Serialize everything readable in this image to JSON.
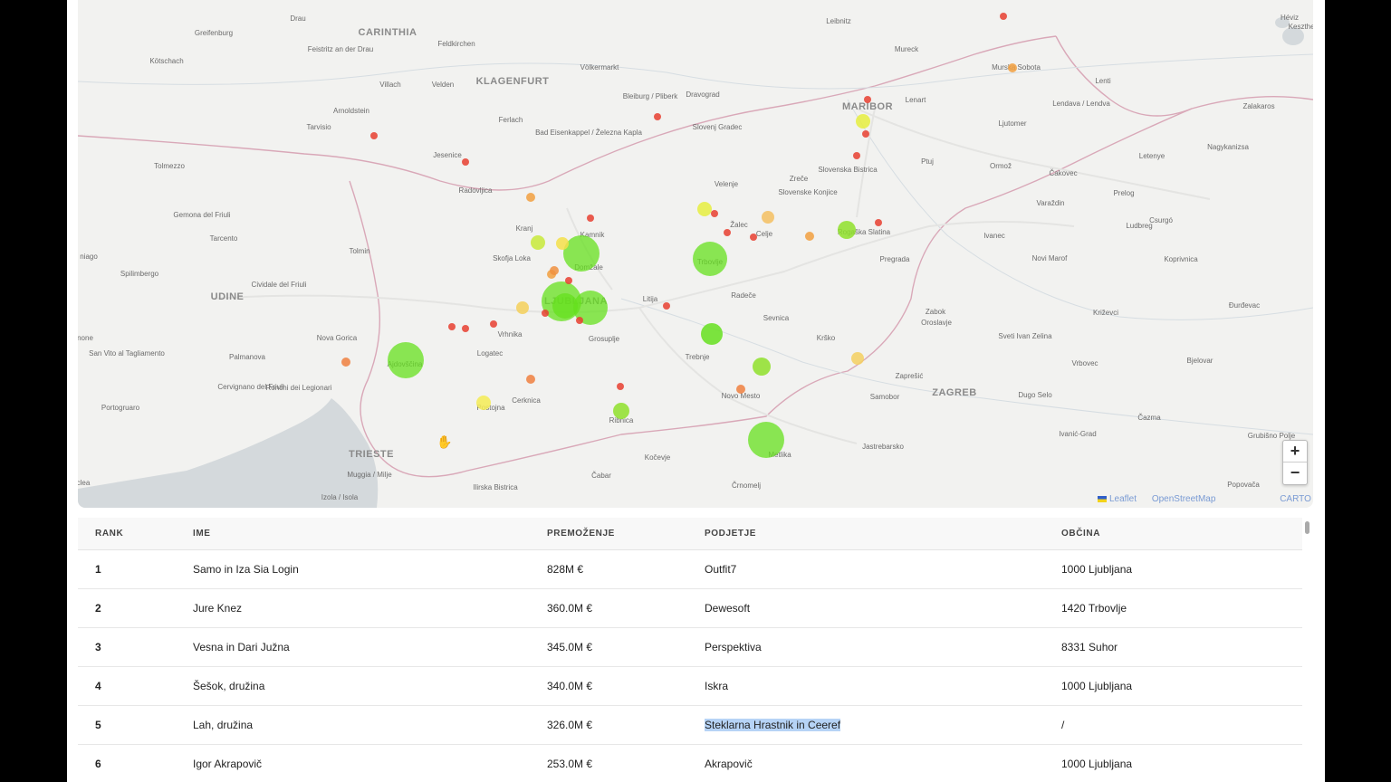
{
  "map": {
    "labels": [
      {
        "name": "Drau",
        "size": "s"
      },
      {
        "name": "CARINTHIA",
        "size": "big"
      },
      {
        "name": "Greifenburg",
        "size": "s"
      },
      {
        "name": "Feistritz an der Drau",
        "size": "s"
      },
      {
        "name": "Feldkirchen",
        "size": "s"
      },
      {
        "name": "Kötschach",
        "size": "s"
      },
      {
        "name": "Völkermarkt",
        "size": "s"
      },
      {
        "name": "KLAGENFURT",
        "size": "big"
      },
      {
        "name": "Villach",
        "size": "s"
      },
      {
        "name": "Velden",
        "size": "s"
      },
      {
        "name": "Arnoldstein",
        "size": "s"
      },
      {
        "name": "Ferlach",
        "size": "s"
      },
      {
        "name": "Bleiburg / Pliberk",
        "size": "s"
      },
      {
        "name": "Dravograd",
        "size": "s"
      },
      {
        "name": "Slovenj Gradec",
        "size": "s"
      },
      {
        "name": "Bad Eisenkappel / Železna Kapla",
        "size": "s"
      },
      {
        "name": "Tarvisio",
        "size": "s"
      },
      {
        "name": "Jesenice",
        "size": "s"
      },
      {
        "name": "Radovljica",
        "size": "s"
      },
      {
        "name": "Tolmezzo",
        "size": "s"
      },
      {
        "name": "Gemona del Friuli",
        "size": "s"
      },
      {
        "name": "Tarcento",
        "size": "s"
      },
      {
        "name": "Tolmin",
        "size": "s"
      },
      {
        "name": "Kranj",
        "size": "s"
      },
      {
        "name": "Kamnik",
        "size": "s"
      },
      {
        "name": "Skofja Loka",
        "size": "s"
      },
      {
        "name": "Domžale",
        "size": "s"
      },
      {
        "name": "Velenje",
        "size": "s"
      },
      {
        "name": "Žalec",
        "size": "s"
      },
      {
        "name": "Celje",
        "size": "s"
      },
      {
        "name": "Trbovlje",
        "size": "s"
      },
      {
        "name": "Litija",
        "size": "s"
      },
      {
        "name": "Radeče",
        "size": "s"
      },
      {
        "name": "Zreče",
        "size": "s"
      },
      {
        "name": "Slovenske Konjice",
        "size": "s"
      },
      {
        "name": "Slovenska Bistrica",
        "size": "s"
      },
      {
        "name": "MARIBOR",
        "size": "big"
      },
      {
        "name": "Lenart",
        "size": "s"
      },
      {
        "name": "Mureck",
        "size": "s"
      },
      {
        "name": "Leibnitz",
        "size": "s"
      },
      {
        "name": "Murska Sobota",
        "size": "s"
      },
      {
        "name": "Ljutomer",
        "size": "s"
      },
      {
        "name": "Ptuj",
        "size": "s"
      },
      {
        "name": "Ormož",
        "size": "s"
      },
      {
        "name": "Lendava / Lendva",
        "size": "s"
      },
      {
        "name": "Lenti",
        "size": "s"
      },
      {
        "name": "Zalakaros",
        "size": "s"
      },
      {
        "name": "Nagykanizsa",
        "size": "s"
      },
      {
        "name": "Letenye",
        "size": "s"
      },
      {
        "name": "Čakovec",
        "size": "s"
      },
      {
        "name": "Varaždin",
        "size": "s"
      },
      {
        "name": "Prelog",
        "size": "s"
      },
      {
        "name": "Ludbreg",
        "size": "s"
      },
      {
        "name": "Csurgó",
        "size": "s"
      },
      {
        "name": "Ivanec",
        "size": "s"
      },
      {
        "name": "Novi Marof",
        "size": "s"
      },
      {
        "name": "Koprivnica",
        "size": "s"
      },
      {
        "name": "Rogaška Slatina",
        "size": "s"
      },
      {
        "name": "Pregrada",
        "size": "s"
      },
      {
        "name": "Zabok",
        "size": "s"
      },
      {
        "name": "Oroslavje",
        "size": "s"
      },
      {
        "name": "Sveti Ivan Zelina",
        "size": "s"
      },
      {
        "name": "Križevci",
        "size": "s"
      },
      {
        "name": "Đurđevac",
        "size": "s"
      },
      {
        "name": "Bjelovar",
        "size": "s"
      },
      {
        "name": "Vrbovec",
        "size": "s"
      },
      {
        "name": "ZAGREB",
        "size": "big"
      },
      {
        "name": "Dugo Selo",
        "size": "s"
      },
      {
        "name": "Samobor",
        "size": "s"
      },
      {
        "name": "Zaprešić",
        "size": "s"
      },
      {
        "name": "Ivanić-Grad",
        "size": "s"
      },
      {
        "name": "Čazma",
        "size": "s"
      },
      {
        "name": "Grubišno Polje",
        "size": "s"
      },
      {
        "name": "Popovača",
        "size": "s"
      },
      {
        "name": "Jastrebarsko",
        "size": "s"
      },
      {
        "name": "Krško",
        "size": "s"
      },
      {
        "name": "Sevnica",
        "size": "s"
      },
      {
        "name": "Trebnje",
        "size": "s"
      },
      {
        "name": "Novo Mesto",
        "size": "s"
      },
      {
        "name": "Metlika",
        "size": "s"
      },
      {
        "name": "Črnomelj",
        "size": "s"
      },
      {
        "name": "Kočevje",
        "size": "s"
      },
      {
        "name": "Ribnica",
        "size": "s"
      },
      {
        "name": "Grosuplje",
        "size": "s"
      },
      {
        "name": "LJUBLJANA",
        "size": "big"
      },
      {
        "name": "Vrhnika",
        "size": "s"
      },
      {
        "name": "Logatec",
        "size": "s"
      },
      {
        "name": "Cerknica",
        "size": "s"
      },
      {
        "name": "Postojna",
        "size": "s"
      },
      {
        "name": "Čabar",
        "size": "s"
      },
      {
        "name": "Ilirska Bistrica",
        "size": "s"
      },
      {
        "name": "Ajdovščina",
        "size": "s"
      },
      {
        "name": "Nova Gorica",
        "size": "s"
      },
      {
        "name": "UDINE",
        "size": "big"
      },
      {
        "name": "Cividale del Friuli",
        "size": "s"
      },
      {
        "name": "Spilimbergo",
        "size": "s"
      },
      {
        "name": "Palmanova",
        "size": "s"
      },
      {
        "name": "San Vito al Tagliamento",
        "size": "s"
      },
      {
        "name": "Cervignano del Friuli",
        "size": "s"
      },
      {
        "name": "Ronchi dei Legionari",
        "size": "s"
      },
      {
        "name": "Portogruaro",
        "size": "s"
      },
      {
        "name": "TRIESTE",
        "size": "big"
      },
      {
        "name": "Muggia / Milje",
        "size": "s"
      },
      {
        "name": "Izola / Isola",
        "size": "s"
      },
      {
        "name": "Héviz",
        "size": "s"
      },
      {
        "name": "Keszthely",
        "size": "s"
      },
      {
        "name": "niago",
        "size": "s"
      },
      {
        "name": "none",
        "size": "s"
      },
      {
        "name": "clea",
        "size": "s"
      },
      {
        "name": "Da",
        "size": "s"
      }
    ],
    "markers": [
      {
        "color": "#66e01e",
        "r": 22,
        "name": "Samo in Iza Sia Login"
      },
      {
        "color": "#66e01e",
        "r": 20
      },
      {
        "color": "#66e01e",
        "r": 19
      },
      {
        "color": "#66e01e",
        "r": 19
      },
      {
        "color": "#66e01e",
        "r": 20
      },
      {
        "color": "#66e01e",
        "r": 20
      },
      {
        "color": "#66e01e",
        "r": 14
      },
      {
        "color": "#66e01e",
        "r": 12
      },
      {
        "color": "#8fe02a",
        "r": 10
      },
      {
        "color": "#8fe02a",
        "r": 10
      },
      {
        "color": "#8fe02a",
        "r": 9
      },
      {
        "color": "#c8ea3a",
        "r": 8
      },
      {
        "color": "#e6ee40",
        "r": 8
      },
      {
        "color": "#e6ee40",
        "r": 8
      },
      {
        "color": "#f5ec55",
        "r": 8
      },
      {
        "color": "#f5e04a",
        "r": 7
      },
      {
        "color": "#f5d05a",
        "r": 7
      },
      {
        "color": "#f5d060",
        "r": 7
      },
      {
        "color": "#f5c060",
        "r": 7
      },
      {
        "color": "#f2a040",
        "r": 5
      },
      {
        "color": "#f2a040",
        "r": 5
      },
      {
        "color": "#f2a040",
        "r": 5
      },
      {
        "color": "#f2a040",
        "r": 5
      },
      {
        "color": "#f09040",
        "r": 5
      },
      {
        "color": "#f08040",
        "r": 5
      },
      {
        "color": "#f08040",
        "r": 5
      },
      {
        "color": "#f08040",
        "r": 5
      },
      {
        "color": "#e84030",
        "r": 4
      },
      {
        "color": "#e84030",
        "r": 4
      },
      {
        "color": "#e84030",
        "r": 4
      },
      {
        "color": "#e84030",
        "r": 4
      },
      {
        "color": "#e84030",
        "r": 4
      },
      {
        "color": "#e84030",
        "r": 4
      },
      {
        "color": "#e84030",
        "r": 4
      },
      {
        "color": "#e84030",
        "r": 4
      },
      {
        "color": "#e84030",
        "r": 4
      },
      {
        "color": "#e84030",
        "r": 4
      },
      {
        "color": "#e84030",
        "r": 4
      },
      {
        "color": "#e84030",
        "r": 4
      },
      {
        "color": "#e84030",
        "r": 4
      },
      {
        "color": "#e84030",
        "r": 4
      },
      {
        "color": "#e84030",
        "r": 4
      },
      {
        "color": "#e84030",
        "r": 4
      },
      {
        "color": "#e84030",
        "r": 4
      },
      {
        "color": "#e84030",
        "r": 4
      },
      {
        "color": "#e84030",
        "r": 4
      },
      {
        "color": "#e84030",
        "r": 4
      }
    ],
    "zoom_in": "+",
    "zoom_out": "−",
    "attribution": {
      "leaflet": "Leaflet",
      "osm": "OpenStreetMap",
      "carto": "CARTO"
    }
  },
  "table": {
    "headers": [
      "RANK",
      "IME",
      "PREMOŽENJE",
      "PODJETJE",
      "OBČINA"
    ],
    "rows": [
      [
        "1",
        "Samo in Iza Sia Login",
        "828M €",
        "Outfit7",
        "1000 Ljubljana"
      ],
      [
        "2",
        "Jure Knez",
        "360.0M €",
        "Dewesoft",
        "1420 Trbovlje"
      ],
      [
        "3",
        "Vesna in Dari Južna",
        "345.0M €",
        "Perspektiva",
        "8331 Suhor"
      ],
      [
        "4",
        "Šešok, družina",
        "340.0M €",
        "Iskra",
        "1000 Ljubljana"
      ],
      [
        "5",
        "Lah, družina",
        "326.0M €",
        "Steklarna Hrastnik in Ceeref",
        "/"
      ],
      [
        "6",
        "Igor Akrapovič",
        "253.0M €",
        "Akrapovič",
        "1000 Ljubljana"
      ]
    ],
    "highlighted_cell": {
      "row": 4,
      "col": 3
    }
  }
}
